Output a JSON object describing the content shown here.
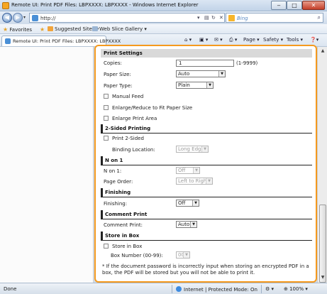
{
  "window": {
    "title": "Remote UI: Print PDF Files: LBPXXXX: LBPXXXX - Windows Internet Explorer",
    "min_label": "‒",
    "max_label": "□",
    "close_label": "✕"
  },
  "address_bar": {
    "url": "http://",
    "search_placeholder": "Bing"
  },
  "favorites_bar": {
    "favorites_label": "Favorites",
    "suggested_sites": "Suggested Sites ▾",
    "web_slice_gallery": "Web Slice Gallery ▾"
  },
  "tab": {
    "label": "Remote UI: Print PDF Files: LBPXXXX: LBPXXXX"
  },
  "command_bar": {
    "page": "Page ▾",
    "safety": "Safety ▾",
    "tools": "Tools ▾"
  },
  "form": {
    "print_settings": {
      "title": "Print Settings",
      "copies_label": "Copies:",
      "copies_value": "1",
      "copies_range": "(1-9999)",
      "paper_size_label": "Paper Size:",
      "paper_size_value": "Auto",
      "paper_type_label": "Paper Type:",
      "paper_type_value": "Plain",
      "manual_feed": "Manual Feed",
      "enlarge_reduce": "Enlarge/Reduce to Fit Paper Size",
      "enlarge_print_area": "Enlarge Print Area"
    },
    "two_sided": {
      "title": "2-Sided Printing",
      "print_2_sided": "Print 2-Sided",
      "binding_location_label": "Binding Location:",
      "binding_location_value": "Long Edge"
    },
    "n_on_1": {
      "title": "N on 1",
      "n_on_1_label": "N on 1:",
      "n_on_1_value": "Off",
      "page_order_label": "Page Order:",
      "page_order_value": "Left to Right"
    },
    "finishing": {
      "title": "Finishing",
      "finishing_label": "Finishing:",
      "finishing_value": "Off"
    },
    "comment_print": {
      "title": "Comment Print",
      "comment_print_label": "Comment Print:",
      "comment_print_value": "Auto"
    },
    "store_in_box": {
      "title": "Store in Box",
      "store_in_box": "Store in Box",
      "box_number_label": "Box Number (00-99):",
      "box_number_value": "00",
      "note_line1": "* If the document password is incorrectly input when storing an encrypted PDF in a",
      "note_line2": "box, the PDF will be stored but you will not be able to print it."
    }
  },
  "status_bar": {
    "status": "Done",
    "zone": "Internet | Protected Mode: On",
    "zoom": "100%"
  },
  "colors": {
    "accent_border": "#f59a1e",
    "section_header_bg": "#d9d9d9"
  }
}
